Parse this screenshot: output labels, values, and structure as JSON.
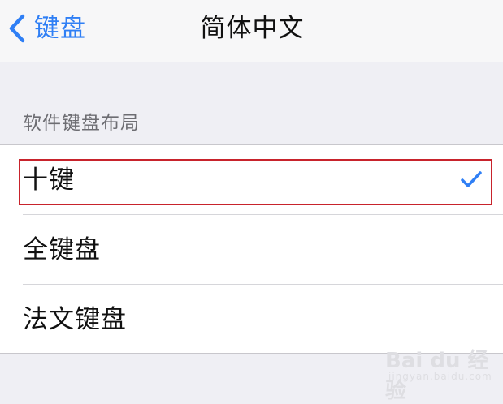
{
  "navbar": {
    "back_label": "键盘",
    "title": "简体中文"
  },
  "section": {
    "header": "软件键盘布局"
  },
  "layouts": [
    {
      "label": "十键",
      "selected": true
    },
    {
      "label": "全键盘",
      "selected": false
    },
    {
      "label": "法文键盘",
      "selected": false
    }
  ],
  "icons": {
    "back": "chevron-left-icon",
    "selected": "checkmark-icon"
  },
  "colors": {
    "accent": "#2f7ff5",
    "highlight": "#c8232c",
    "background": "#efeff4"
  },
  "watermark": {
    "text": "Bai du 经验",
    "url": "jingyan.baidu.com"
  }
}
